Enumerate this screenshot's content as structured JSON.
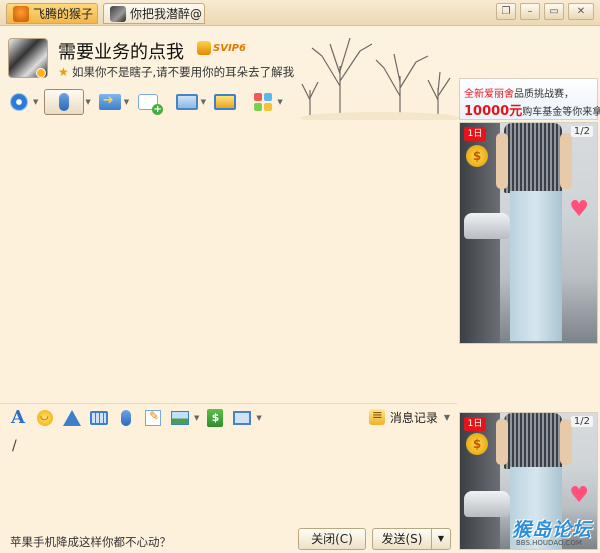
{
  "tabs": [
    {
      "label": "飞腾的猴子",
      "active": true
    },
    {
      "label": "你把我潜醉@",
      "active": false
    }
  ],
  "window_controls": {
    "restore": "❐",
    "minimize": "–",
    "maximize": "▭",
    "close": "✕"
  },
  "contact": {
    "name": "需要业务的点我",
    "vip_badge": "SVIP6",
    "signature": "如果你不是瞎子,请不要用你的耳朵去了解我"
  },
  "toolbar": {
    "icons": [
      "camera-icon",
      "microphone-icon",
      "file-transfer-icon",
      "create-discussion-icon",
      "remote-desktop-icon",
      "screen-share-icon",
      "apps-icon"
    ]
  },
  "ad": {
    "line1_red": "全新爱丽舍",
    "line1_rest": "品质挑战赛，",
    "line2_big": "10000元",
    "line2_rest": "购车基金等你来拿"
  },
  "photos": [
    {
      "counter": "1/2",
      "badge": "1日"
    },
    {
      "counter": "1/2",
      "badge": "1日"
    }
  ],
  "input_toolbar": {
    "icons": [
      "font-icon",
      "emoji-icon",
      "shake-icon",
      "magic-face-icon",
      "voice-message-icon",
      "note-icon",
      "image-icon",
      "red-packet-icon",
      "screenshot-icon"
    ],
    "history_label": "消息记录"
  },
  "input": {
    "caret": "/"
  },
  "bottom": {
    "tip": "苹果手机降成这样你都不心动？",
    "close_label": "关闭(C)",
    "send_label": "发送(S)"
  },
  "watermark": {
    "main": "猴岛论坛",
    "sub": "BBS.HOUDAO.COM"
  },
  "colors": {
    "background": "#fdf1dc",
    "tab_active": "#f2b74a",
    "accent_blue": "#2c7cd6",
    "ad_red": "#e4141b"
  }
}
